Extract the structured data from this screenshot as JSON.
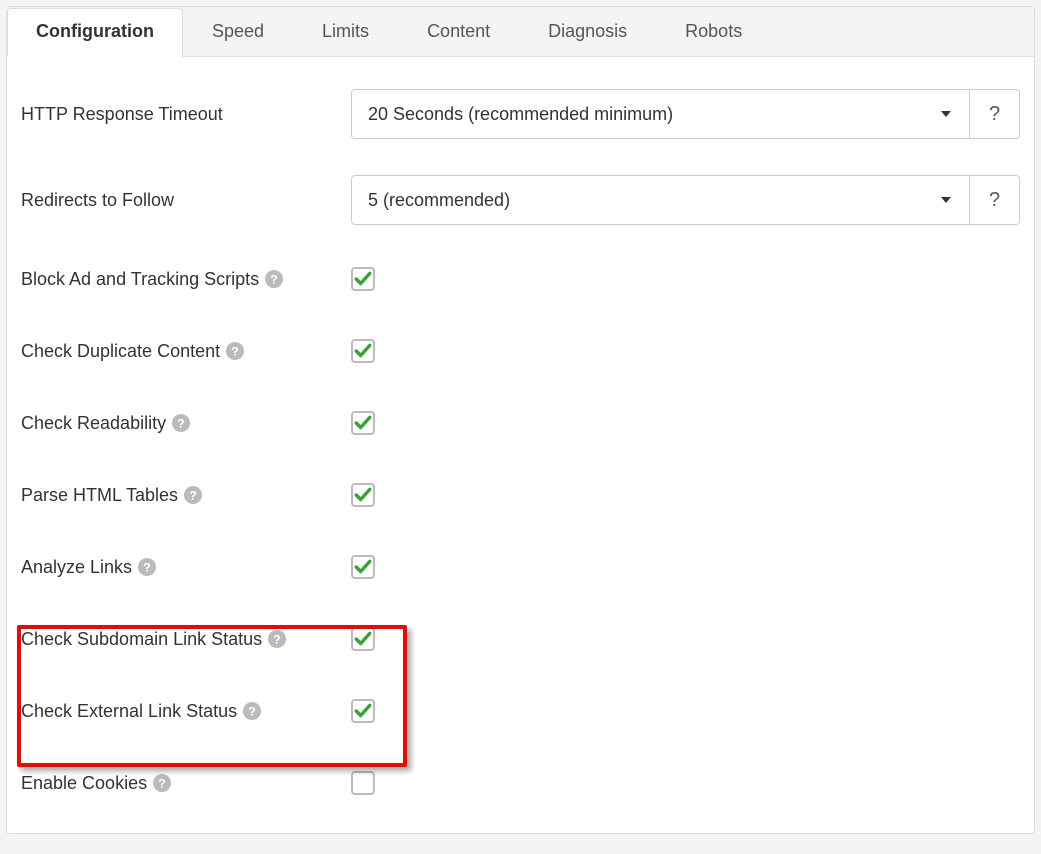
{
  "tabs": {
    "items": [
      {
        "label": "Configuration",
        "active": true
      },
      {
        "label": "Speed",
        "active": false
      },
      {
        "label": "Limits",
        "active": false
      },
      {
        "label": "Content",
        "active": false
      },
      {
        "label": "Diagnosis",
        "active": false
      },
      {
        "label": "Robots",
        "active": false
      }
    ]
  },
  "dropdowns": {
    "http_timeout": {
      "label": "HTTP Response Timeout",
      "value": "20 Seconds (recommended minimum)",
      "help": "?"
    },
    "redirects": {
      "label": "Redirects to Follow",
      "value": "5 (recommended)",
      "help": "?"
    }
  },
  "checkboxes": {
    "block_ads": {
      "label": "Block Ad and Tracking Scripts",
      "checked": true
    },
    "dup_content": {
      "label": "Check Duplicate Content",
      "checked": true
    },
    "readability": {
      "label": "Check Readability",
      "checked": true
    },
    "parse_tables": {
      "label": "Parse HTML Tables",
      "checked": true
    },
    "analyze_links": {
      "label": "Analyze Links",
      "checked": true
    },
    "subdomain_links": {
      "label": "Check Subdomain Link Status",
      "checked": true
    },
    "external_links": {
      "label": "Check External Link Status",
      "checked": true
    },
    "enable_cookies": {
      "label": "Enable Cookies",
      "checked": false
    }
  }
}
